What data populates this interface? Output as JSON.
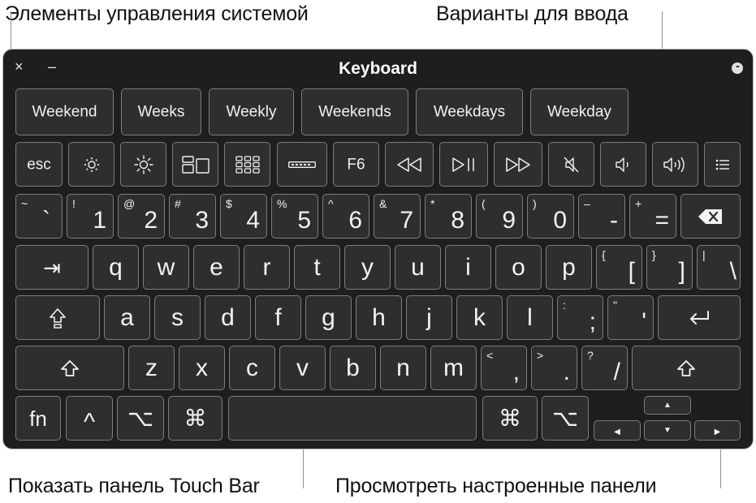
{
  "callouts": {
    "system_controls": "Элементы управления системой",
    "typing_suggestions": "Варианты для ввода",
    "show_touch_bar": "Показать панель Touch Bar",
    "view_custom_panels": "Просмотреть настроенные панели"
  },
  "window": {
    "title": "Keyboard",
    "close_glyph": "×",
    "minimize_glyph": "–",
    "more_glyph": "•••"
  },
  "suggestions": [
    "Weekend",
    "Weeks",
    "Weekly",
    "Weekends",
    "Weekdays",
    "Weekday"
  ],
  "function_row": {
    "esc": "esc",
    "f6": "F6",
    "icons": [
      "brightness-down-icon",
      "brightness-up-icon",
      "mission-control-icon",
      "launchpad-icon",
      "touch-bar-icon",
      "rewind-icon",
      "play-pause-icon",
      "fast-forward-icon",
      "mute-icon",
      "volume-down-icon",
      "volume-up-icon",
      "panels-list-icon"
    ]
  },
  "number_row": [
    {
      "sub": "~",
      "main": "`"
    },
    {
      "sub": "!",
      "main": "1"
    },
    {
      "sub": "@",
      "main": "2"
    },
    {
      "sub": "#",
      "main": "3"
    },
    {
      "sub": "$",
      "main": "4"
    },
    {
      "sub": "%",
      "main": "5"
    },
    {
      "sub": "^",
      "main": "6"
    },
    {
      "sub": "&",
      "main": "7"
    },
    {
      "sub": "*",
      "main": "8"
    },
    {
      "sub": "(",
      "main": "9"
    },
    {
      "sub": ")",
      "main": "0"
    },
    {
      "sub": "–",
      "main": "-"
    },
    {
      "sub": "+",
      "main": "="
    }
  ],
  "qwerty_row": [
    "q",
    "w",
    "e",
    "r",
    "t",
    "y",
    "u",
    "i",
    "o",
    "p"
  ],
  "qwerty_extra": [
    {
      "sub": "{",
      "main": "["
    },
    {
      "sub": "}",
      "main": "]"
    },
    {
      "sub": "|",
      "main": "\\"
    }
  ],
  "home_row": [
    "a",
    "s",
    "d",
    "f",
    "g",
    "h",
    "j",
    "k",
    "l"
  ],
  "home_extra": [
    {
      "sub": ":",
      "main": ";"
    },
    {
      "sub": "\"",
      "main": "'"
    }
  ],
  "bottom_letters": [
    "z",
    "x",
    "c",
    "v",
    "b",
    "n",
    "m"
  ],
  "bottom_extra": [
    {
      "sub": "<",
      "main": ","
    },
    {
      "sub": ">",
      "main": "."
    },
    {
      "sub": "?",
      "main": "/"
    }
  ],
  "modifiers": {
    "fn": "fn",
    "control": "^",
    "option": "⌥",
    "command": "⌘",
    "tab": "⇥",
    "arrow_up": "▲",
    "arrow_down": "▼",
    "arrow_left": "◀",
    "arrow_right": "▶"
  }
}
